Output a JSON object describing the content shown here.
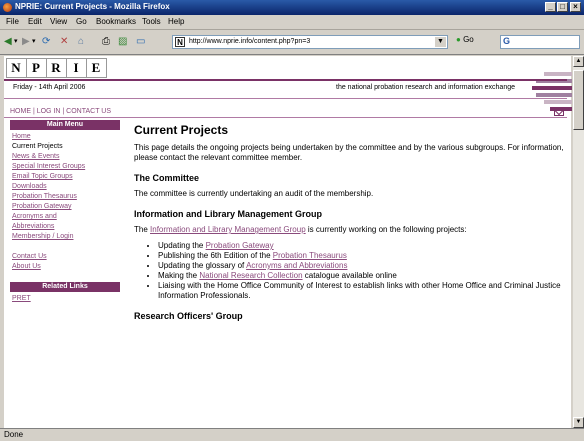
{
  "window": {
    "title": "NPRIE: Current Projects - Mozilla Firefox",
    "controls": [
      "_",
      "□",
      "×"
    ]
  },
  "menubar": [
    "File",
    "Edit",
    "View",
    "Go",
    "Bookmarks",
    "Tools",
    "Help"
  ],
  "toolbar": {
    "url": "http://www.nprie.info/content.php?pn=3",
    "go_label": "Go",
    "search_placeholder": "G"
  },
  "status_text": "Done",
  "site": {
    "logo_letters": [
      "N",
      "P",
      "R",
      "I",
      "E"
    ],
    "date": "Friday - 14th April 2006",
    "tagline": "the national probation research and information exchange",
    "topnav": [
      "HOME",
      "LOG IN",
      "CONTACT US"
    ],
    "brand_color": "#7a3266"
  },
  "sidebar": {
    "main_menu_title": "Main Menu",
    "items": [
      "Home",
      "Current Projects",
      "News & Events",
      "Special Interest Groups",
      "Email Topic Groups",
      "Downloads",
      "Probation Thesaurus",
      "Probation Gateway",
      "Acronyms and Abbreviations",
      "Membership / Login"
    ],
    "items2": [
      "Contact Us",
      "About Us"
    ],
    "related_title": "Related Links",
    "related_items": [
      "PRET"
    ]
  },
  "main": {
    "title": "Current Projects",
    "intro": "This page details the ongoing projects being undertaken by the committee and by the various subgroups. For information, please contact the relevant committee member.",
    "committee_heading": "The Committee",
    "committee_text": "The committee is currently undertaking an audit of the membership.",
    "ilmg_heading": "Information and Library Management Group",
    "ilmg_intro_pre": "The ",
    "ilmg_link": "Information and Library Management Group",
    "ilmg_intro_post": " is currently working on the following projects:",
    "projects": [
      {
        "pre": "Updating the ",
        "link": "Probation Gateway",
        "post": ""
      },
      {
        "pre": "Publishing the 6th Edition of the ",
        "link": "Probation Thesaurus",
        "post": ""
      },
      {
        "pre": "Updating the glossary of ",
        "link": "Acronyms and Abbreviations",
        "post": ""
      },
      {
        "pre": "Making the ",
        "link": "National Research Collection",
        "post": " catalogue available online"
      },
      {
        "pre": "Liaising with the Home Office Community of Interest to establish links with other Home Office and Criminal Justice Information Professionals.",
        "link": "",
        "post": ""
      }
    ],
    "rog_heading": "Research Officers' Group"
  }
}
